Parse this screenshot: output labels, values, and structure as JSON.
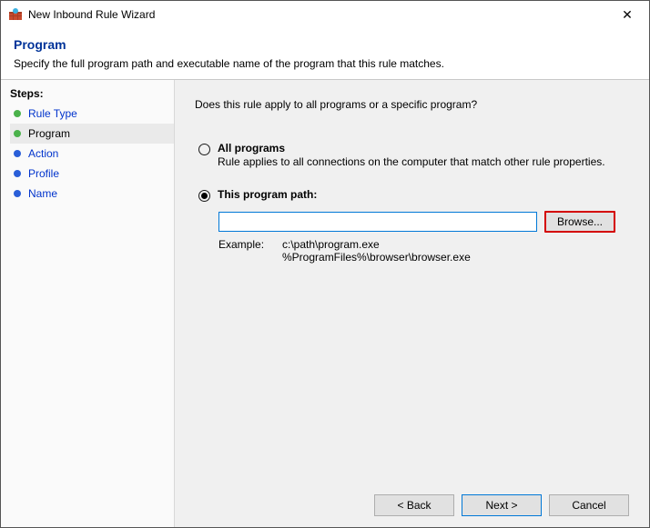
{
  "window": {
    "title": "New Inbound Rule Wizard",
    "close_label": "✕"
  },
  "header": {
    "heading": "Program",
    "description": "Specify the full program path and executable name of the program that this rule matches."
  },
  "sidebar": {
    "title": "Steps:",
    "items": [
      {
        "label": "Rule Type",
        "status": "done"
      },
      {
        "label": "Program",
        "status": "current"
      },
      {
        "label": "Action",
        "status": "pending"
      },
      {
        "label": "Profile",
        "status": "pending"
      },
      {
        "label": "Name",
        "status": "pending"
      }
    ]
  },
  "content": {
    "question": "Does this rule apply to all programs or a specific program?",
    "opt_all": {
      "title": "All programs",
      "sub": "Rule applies to all connections on the computer that match other rule properties."
    },
    "opt_path": {
      "title": "This program path:",
      "input_value": "",
      "browse_label": "Browse...",
      "example_label": "Example:",
      "example_lines": "c:\\path\\program.exe\n%ProgramFiles%\\browser\\browser.exe"
    }
  },
  "footer": {
    "back": "< Back",
    "next": "Next >",
    "cancel": "Cancel"
  }
}
